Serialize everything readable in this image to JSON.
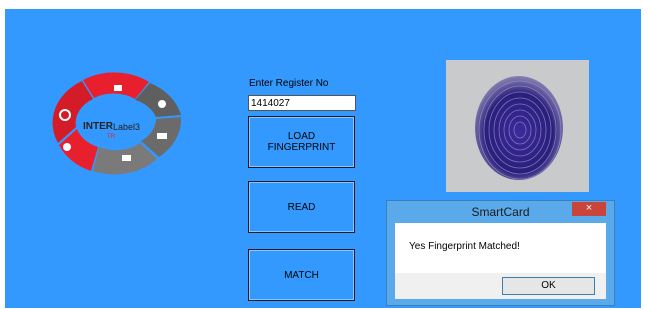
{
  "logo": {
    "brand": "INTER",
    "product": "Label3",
    "sub": "TR"
  },
  "register": {
    "label": "Enter Register No",
    "value": "1414027"
  },
  "buttons": {
    "load_line1": "LOAD",
    "load_line2": "FINGERPRINT",
    "read": "READ",
    "match": "MATCH"
  },
  "dialog": {
    "title": "SmartCard",
    "close": "×",
    "message": "Yes Fingerprint Matched!",
    "ok": "OK"
  },
  "colors": {
    "background": "#3399ff",
    "ring_red": "#e8202e",
    "ring_gray": "#5f5f5f",
    "dialog_frame": "#5aa9ea",
    "close_red": "#c9443a"
  },
  "icons": {
    "logo_segments": [
      "laptop-icon",
      "people-icon",
      "factory-icon",
      "devices-icon",
      "location-pin-icon",
      "refresh-icon"
    ],
    "fingerprint": "fingerprint-image"
  }
}
